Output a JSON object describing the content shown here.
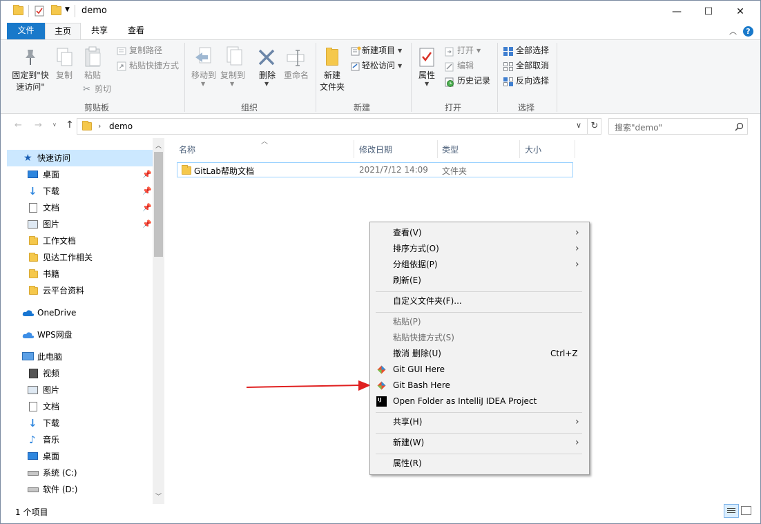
{
  "window": {
    "title": "demo",
    "controls": {
      "minimize": "—",
      "maximize": "☐",
      "close": "✕"
    }
  },
  "tabs": [
    "文件",
    "主页",
    "共享",
    "查看"
  ],
  "ribbon": {
    "clipboard": {
      "pin_label": "固定到\"快\n速访问\"",
      "copy": "复制",
      "paste": "粘贴",
      "copy_path": "复制路径",
      "paste_shortcut": "粘贴快捷方式",
      "cut": "剪切",
      "group": "剪贴板"
    },
    "organize": {
      "move_to": "移动到",
      "copy_to": "复制到",
      "delete": "删除",
      "rename": "重命名",
      "group": "组织"
    },
    "new": {
      "new_folder": "新建\n文件夹",
      "new_item": "新建项目",
      "easy_access": "轻松访问",
      "group": "新建"
    },
    "open": {
      "properties": "属性",
      "open": "打开",
      "edit": "编辑",
      "history": "历史记录",
      "group": "打开"
    },
    "select": {
      "select_all": "全部选择",
      "select_none": "全部取消",
      "invert": "反向选择",
      "group": "选择"
    }
  },
  "address": {
    "path": "demo",
    "search_placeholder": "搜索\"demo\""
  },
  "nav": {
    "quick_access": "快速访问",
    "quick_items": [
      "桌面",
      "下载",
      "文档",
      "图片",
      "工作文档",
      "见达工作相关",
      "书籍",
      "云平台资料"
    ],
    "onedrive": "OneDrive",
    "wps": "WPS网盘",
    "this_pc": "此电脑",
    "pc_items": [
      "视频",
      "图片",
      "文档",
      "下载",
      "音乐",
      "桌面",
      "系统 (C:)",
      "软件 (D:)"
    ]
  },
  "columns": {
    "name": "名称",
    "date": "修改日期",
    "type": "类型",
    "size": "大小"
  },
  "files": [
    {
      "name": "GitLab帮助文档",
      "date": "2021/7/12 14:09",
      "type": "文件夹",
      "size": ""
    }
  ],
  "status": {
    "count": "1 个项目"
  },
  "context_menu": {
    "view": "查看(V)",
    "sort": "排序方式(O)",
    "group": "分组依据(P)",
    "refresh": "刷新(E)",
    "customize": "自定义文件夹(F)...",
    "paste": "粘贴(P)",
    "paste_shortcut": "粘贴快捷方式(S)",
    "undo": "撤消 删除(U)",
    "undo_key": "Ctrl+Z",
    "git_gui": "Git GUI Here",
    "git_bash": "Git Bash Here",
    "idea": "Open Folder as IntelliJ IDEA Project",
    "share": "共享(H)",
    "new": "新建(W)",
    "properties": "属性(R)"
  },
  "colors": {
    "accent": "#1979ca",
    "arrow": "#e02020",
    "folder": "#f5c84c"
  }
}
